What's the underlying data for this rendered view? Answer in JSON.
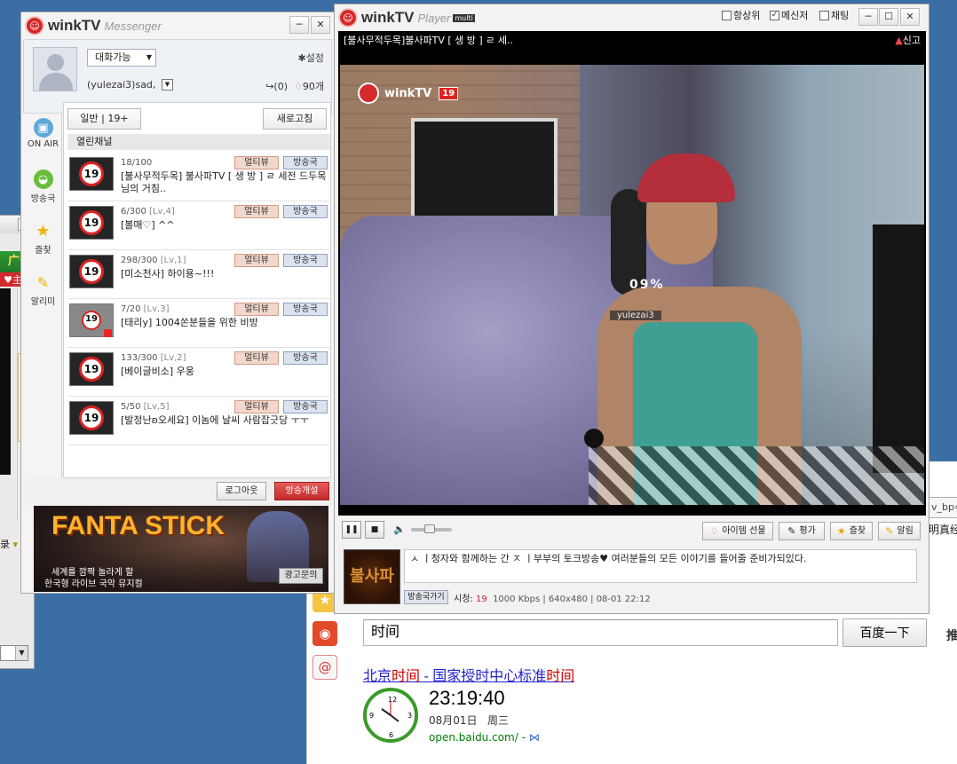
{
  "browser": {
    "url_fragment": "v_bp=",
    "cn_text_cut": "明真经",
    "search": {
      "query": "时间",
      "button": "百度一下"
    },
    "push_cut": "推",
    "result": {
      "title_parts": [
        "北京",
        "时间",
        " - 国家授时中心标准",
        "时间"
      ]
    },
    "clock": {
      "time": "23:19:40",
      "date": "08月01日",
      "weekday": "周三",
      "url": "open.baidu.com/ -"
    },
    "sidebar_icons": [
      "star-icon",
      "weibo-icon",
      "email-icon"
    ]
  },
  "side_popup": {
    "close": "✕",
    "ad_text": "广告",
    "ad_text2": "♥主角",
    "label": "录"
  },
  "messenger": {
    "app_name": "winkTV",
    "app_sub": "Messenger",
    "status": "대화가능",
    "settings": "설정",
    "username": "(yulezai3)sad,",
    "reply_count": "(0)",
    "balloon_count": "90개",
    "rail": [
      {
        "label": "ON AIR",
        "icon": "tv-icon"
      },
      {
        "label": "방송국",
        "icon": "broadcast-icon"
      },
      {
        "label": "즐찾",
        "icon": "star-icon"
      },
      {
        "label": "알리미",
        "icon": "bell-icon"
      }
    ],
    "filter": "일반 | 19+",
    "refresh": "새로고침",
    "open_channels": "열린채널",
    "tag_multi": "멀티뷰",
    "tag_station": "방송국",
    "channels": [
      {
        "count": "18/100",
        "level": "",
        "title": "[불사무적두목] 불사파TV [ 생 방 ] ㄹ 세전 드두목님의 거침..",
        "locked": false
      },
      {
        "count": "6/300",
        "level": "[Lv,4]",
        "title": "[볼매♡] ^^",
        "locked": false
      },
      {
        "count": "298/300",
        "level": "[Lv,1]",
        "title": "[미소천사] 하이용~!!!",
        "locked": false
      },
      {
        "count": "7/20",
        "level": "[Lv,3]",
        "title": "[태리y] 1004쏜분들을 위한 비방",
        "locked": true
      },
      {
        "count": "133/300",
        "level": "[Lv,2]",
        "title": "[베이글비소] 우웅",
        "locked": false
      },
      {
        "count": "5/50",
        "level": "[Lv,5]",
        "title": "[발정난ʚ오세요] 이놈에 날씨 사람잡긋당 ㅜㅜ",
        "locked": false
      }
    ],
    "logout": "로그아웃",
    "start_broadcast": "방송개설",
    "ad": {
      "title": "FANTA STICK",
      "line1": "세계를 깜짝 놀라게 할",
      "line2": "한국형 라이브 국악 뮤지컬",
      "inquiry": "광고문의"
    }
  },
  "player": {
    "app_name": "winkTV",
    "app_sub": "Player",
    "badge": "multi",
    "options": [
      {
        "label": "항상위",
        "checked": false
      },
      {
        "label": "메신저",
        "checked": true
      },
      {
        "label": "채팅",
        "checked": false
      }
    ],
    "video_title": "[불사무적두목]불사파TV [ 생 방 ] ㄹ 세..",
    "report": "신고",
    "overlay_logo": "winkTV",
    "overlay_age": "19",
    "overlay_percent": "09%",
    "overlay_name": "yulezai3",
    "volume_level": 0.45,
    "buttons": {
      "gift": "아이템 선물",
      "rate": "평가",
      "favorite": "즐찾",
      "alarm": "알림"
    },
    "description": "ㅅ ㅣ청자와 함께하는 간 ㅈ ㅣ부부의 토크방송♥ 여러분들의 모든 이야기를 들어줄 준비가되있다.",
    "thumb_text": "불사파",
    "go_station": "방송국가기",
    "stats": {
      "label": "시청:",
      "viewers": "19",
      "rest": "1000 Kbps | 640x480 | 08-01 22:12"
    }
  }
}
